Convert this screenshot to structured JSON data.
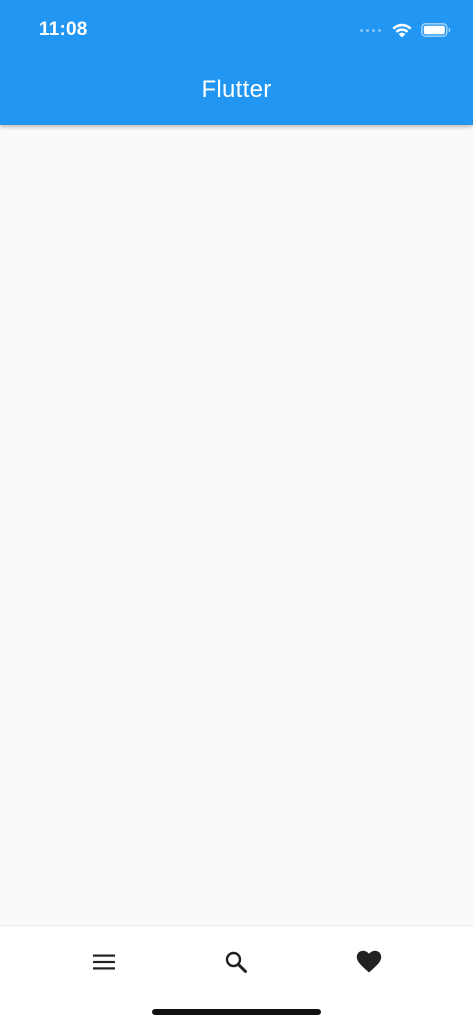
{
  "status_bar": {
    "time": "11:08",
    "icons": [
      "signal-dots-icon",
      "wifi-icon",
      "battery-icon"
    ]
  },
  "app_bar": {
    "title": "Flutter",
    "color": "#2196f3"
  },
  "bottom_nav": {
    "items": [
      {
        "icon": "menu-icon"
      },
      {
        "icon": "search-icon"
      },
      {
        "icon": "heart-icon"
      }
    ],
    "icon_color": "#212121"
  }
}
